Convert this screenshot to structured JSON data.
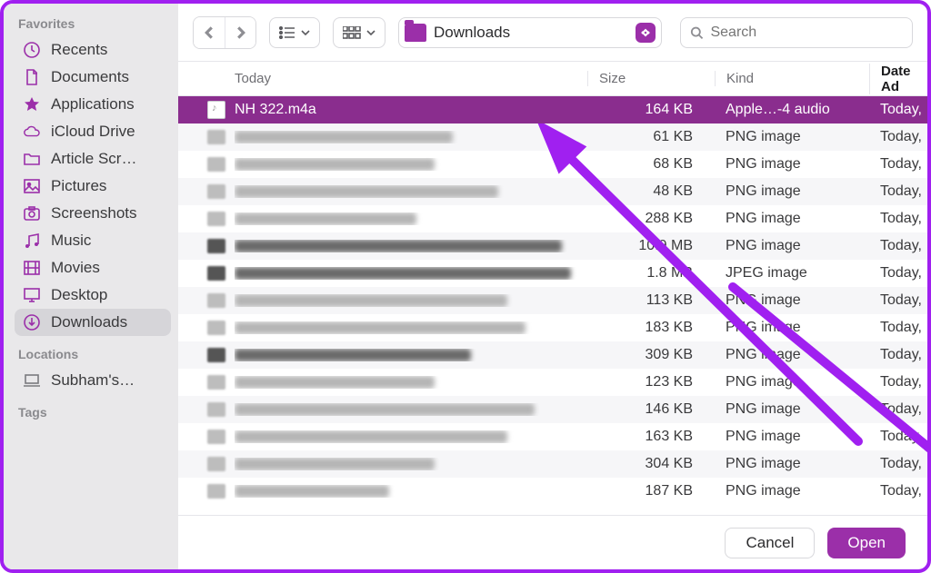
{
  "sidebar": {
    "favorites_label": "Favorites",
    "items": [
      {
        "icon": "clock",
        "label": "Recents"
      },
      {
        "icon": "doc",
        "label": "Documents"
      },
      {
        "icon": "app",
        "label": "Applications"
      },
      {
        "icon": "cloud",
        "label": "iCloud Drive"
      },
      {
        "icon": "folder",
        "label": "Article Scr…"
      },
      {
        "icon": "image",
        "label": "Pictures"
      },
      {
        "icon": "camera",
        "label": "Screenshots"
      },
      {
        "icon": "music",
        "label": "Music"
      },
      {
        "icon": "film",
        "label": "Movies"
      },
      {
        "icon": "desktop",
        "label": "Desktop"
      },
      {
        "icon": "download",
        "label": "Downloads",
        "selected": true
      }
    ],
    "locations_label": "Locations",
    "locations": [
      {
        "icon": "laptop",
        "label": "Subham's…"
      }
    ],
    "tags_label": "Tags"
  },
  "toolbar": {
    "location": "Downloads",
    "search_placeholder": "Search"
  },
  "columns": {
    "name": "Today",
    "size": "Size",
    "kind": "Kind",
    "date": "Date Ad"
  },
  "rows": [
    {
      "sel": true,
      "name": "NH 322.m4a",
      "size": "164 KB",
      "kind": "Apple…-4 audio",
      "date": "Today,",
      "audio": true,
      "nw": 90
    },
    {
      "size": "61 KB",
      "kind": "PNG image",
      "date": "Today,",
      "nw": 240
    },
    {
      "size": "68 KB",
      "kind": "PNG image",
      "date": "Today,",
      "nw": 220
    },
    {
      "size": "48 KB",
      "kind": "PNG image",
      "date": "Today,",
      "nw": 290
    },
    {
      "size": "288 KB",
      "kind": "PNG image",
      "date": "Today,",
      "nw": 200
    },
    {
      "size": "10.9 MB",
      "kind": "PNG image",
      "date": "Today,",
      "nw": 360,
      "dark": true
    },
    {
      "size": "1.8 MB",
      "kind": "JPEG image",
      "date": "Today,",
      "nw": 370,
      "dark": true
    },
    {
      "size": "113 KB",
      "kind": "PNG image",
      "date": "Today,",
      "nw": 300
    },
    {
      "size": "183 KB",
      "kind": "PNG image",
      "date": "Today,",
      "nw": 320
    },
    {
      "size": "309 KB",
      "kind": "PNG image",
      "date": "Today,",
      "nw": 260,
      "dark": true
    },
    {
      "size": "123 KB",
      "kind": "PNG image",
      "date": "Today,",
      "nw": 220
    },
    {
      "size": "146 KB",
      "kind": "PNG image",
      "date": "Today,",
      "nw": 330
    },
    {
      "size": "163 KB",
      "kind": "PNG image",
      "date": "Today,",
      "nw": 300
    },
    {
      "size": "304 KB",
      "kind": "PNG image",
      "date": "Today,",
      "nw": 220
    },
    {
      "size": "187 KB",
      "kind": "PNG image",
      "date": "Today,",
      "nw": 170
    }
  ],
  "footer": {
    "cancel": "Cancel",
    "open": "Open"
  }
}
